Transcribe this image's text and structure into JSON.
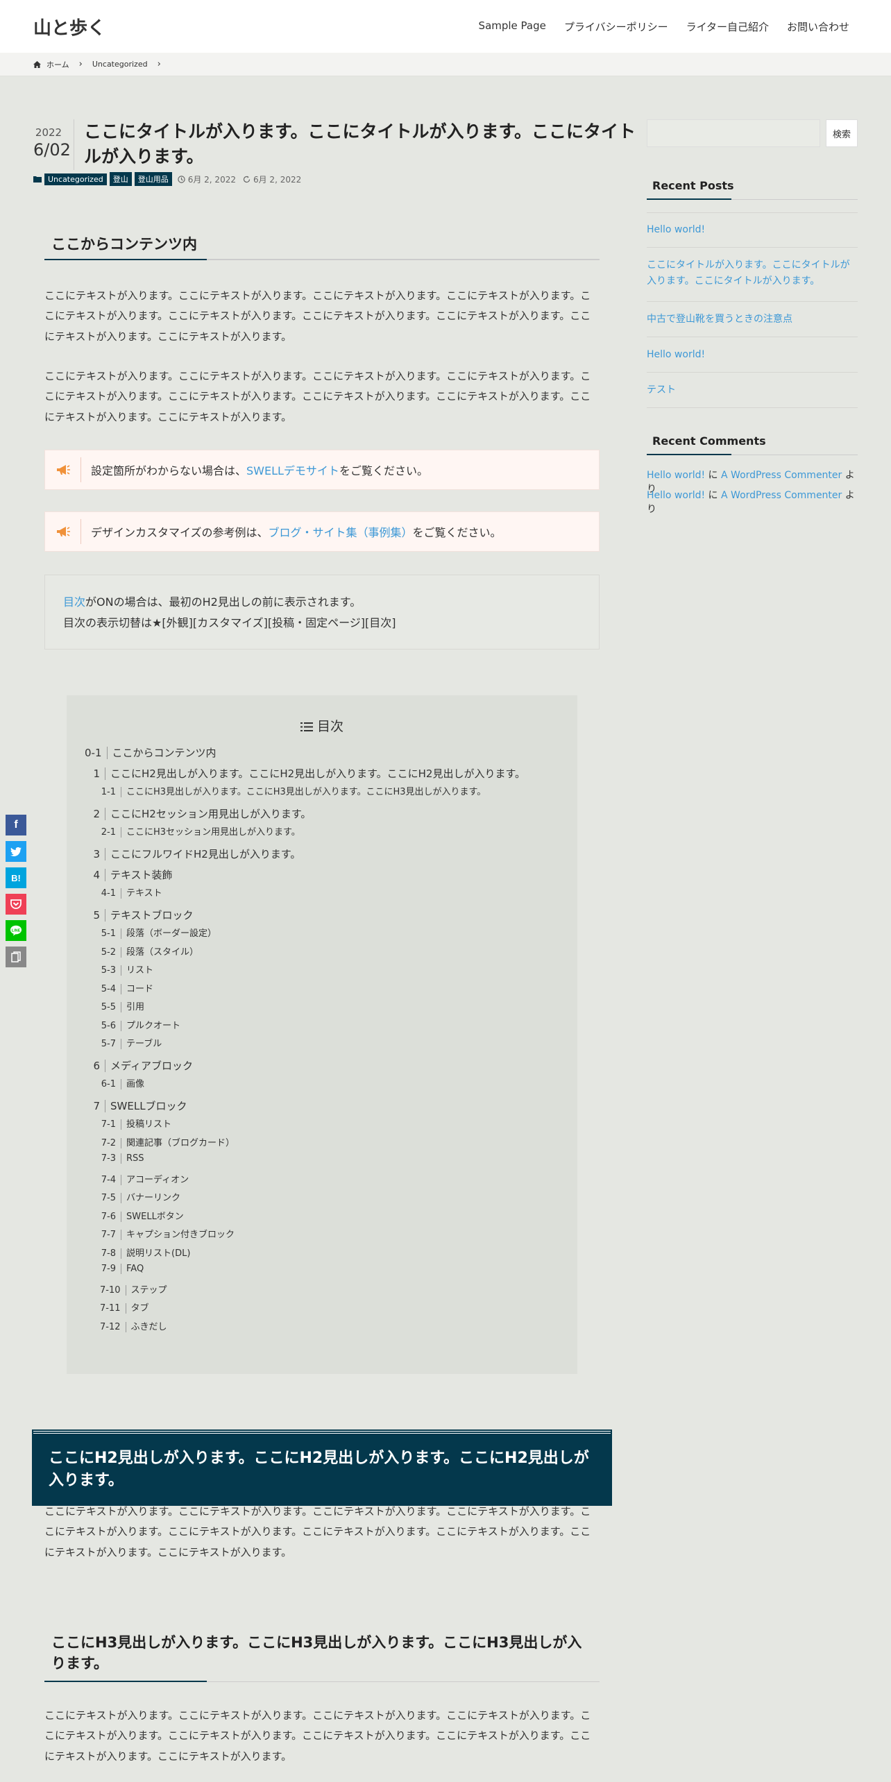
{
  "header": {
    "site_title": "山と歩く",
    "nav": [
      "Sample Page",
      "プライバシーポリシー",
      "ライター自己紹介",
      "お問い合わせ"
    ]
  },
  "breadcrumb": {
    "home": "ホーム",
    "category": "Uncategorized"
  },
  "post": {
    "year": "2022",
    "date": "6/02",
    "title": "ここにタイトルが入ります。ここにタイトルが入ります。ここにタイトルが入ります。",
    "tags": [
      "Uncategorized",
      "登山",
      "登山用品"
    ],
    "published": "6月 2, 2022",
    "modified": "6月 2, 2022",
    "h2_first": "ここからコンテンツ内",
    "paragraph": "ここにテキストが入ります。ここにテキストが入ります。ここにテキストが入ります。ここにテキストが入ります。ここにテキストが入ります。ここにテキストが入ります。ここにテキストが入ります。ここにテキストが入ります。ここにテキストが入ります。ここにテキストが入ります。",
    "cap1": {
      "before": "設定箇所がわからない場合は、",
      "link": "SWELLデモサイト",
      "after": "をご覧ください。"
    },
    "cap2": {
      "before": "デザインカスタマイズの参考例は、",
      "link": "ブログ・サイト集（事例集）",
      "after": "をご覧ください。"
    },
    "info": {
      "link": "目次",
      "line1": "がONの場合は、最初のH2見出しの前に表示されます。",
      "line2": "目次の表示切替は★[外観][カスタマイズ][投稿・固定ページ][目次]"
    },
    "h2_banner": "ここにH2見出しが入ります。ここにH2見出しが入ります。ここにH2見出しが入ります。",
    "h3": "ここにH3見出しが入ります。ここにH3見出しが入ります。ここにH3見出しが入ります。"
  },
  "toc": {
    "title": "目次",
    "items": [
      {
        "num": "0-1",
        "text": "ここからコンテンツ内"
      },
      {
        "num": "1",
        "text": "ここにH2見出しが入ります。ここにH2見出しが入ります。ここにH2見出しが入ります。"
      },
      {
        "num": "1-1",
        "text": "ここにH3見出しが入ります。ここにH3見出しが入ります。ここにH3見出しが入ります。"
      },
      {
        "num": "2",
        "text": "ここにH2セッション用見出しが入ります。"
      },
      {
        "num": "2-1",
        "text": "ここにH3セッション用見出しが入ります。"
      },
      {
        "num": "3",
        "text": "ここにフルワイドH2見出しが入ります。"
      },
      {
        "num": "4",
        "text": "テキスト装飾"
      },
      {
        "num": "4-1",
        "text": "テキスト"
      },
      {
        "num": "5",
        "text": "テキストブロック"
      },
      {
        "num": "5-1",
        "text": "段落（ボーダー設定）"
      },
      {
        "num": "5-2",
        "text": "段落（スタイル）"
      },
      {
        "num": "5-3",
        "text": "リスト"
      },
      {
        "num": "5-4",
        "text": "コード"
      },
      {
        "num": "5-5",
        "text": "引用"
      },
      {
        "num": "5-6",
        "text": "プルクオート"
      },
      {
        "num": "5-7",
        "text": "テーブル"
      },
      {
        "num": "6",
        "text": "メディアブロック"
      },
      {
        "num": "6-1",
        "text": "画像"
      },
      {
        "num": "7",
        "text": "SWELLブロック"
      },
      {
        "num": "7-1",
        "text": "投稿リスト"
      },
      {
        "num": "7-2",
        "text": "関連記事（ブログカード）"
      },
      {
        "num": "7-3",
        "text": "RSS"
      },
      {
        "num": "7-4",
        "text": "アコーディオン"
      },
      {
        "num": "7-5",
        "text": "バナーリンク"
      },
      {
        "num": "7-6",
        "text": "SWELLボタン"
      },
      {
        "num": "7-7",
        "text": "キャプション付きブロック"
      },
      {
        "num": "7-8",
        "text": "説明リスト(DL)"
      },
      {
        "num": "7-9",
        "text": "FAQ"
      },
      {
        "num": "7-10",
        "text": "ステップ"
      },
      {
        "num": "7-11",
        "text": "タブ"
      },
      {
        "num": "7-12",
        "text": "ふきだし"
      }
    ]
  },
  "sidebar": {
    "search_button": "検索",
    "recent_posts_title": "Recent Posts",
    "recent_posts": [
      "Hello world!",
      "ここにタイトルが入ります。ここにタイトルが入ります。ここにタイトルが入ります。",
      "中古で登山靴を買うときの注意点",
      "Hello world!",
      "テスト"
    ],
    "recent_comments_title": "Recent Comments",
    "recent_comments": [
      {
        "post": "Hello world!",
        "on": " に ",
        "author": "A WordPress Commenter",
        "suffix": " より"
      },
      {
        "post": "Hello world!",
        "on": " に ",
        "author": "A WordPress Commenter",
        "suffix": " より"
      }
    ]
  },
  "share": {
    "hatena_label": "B!"
  },
  "colors": {
    "accent": "#04384c",
    "link": "#3d98d6",
    "facebook": "#3b5998",
    "twitter": "#1da1f2",
    "hatena": "#00a4de",
    "pocket": "#ef4056",
    "line": "#00c300",
    "copy": "#888888"
  }
}
